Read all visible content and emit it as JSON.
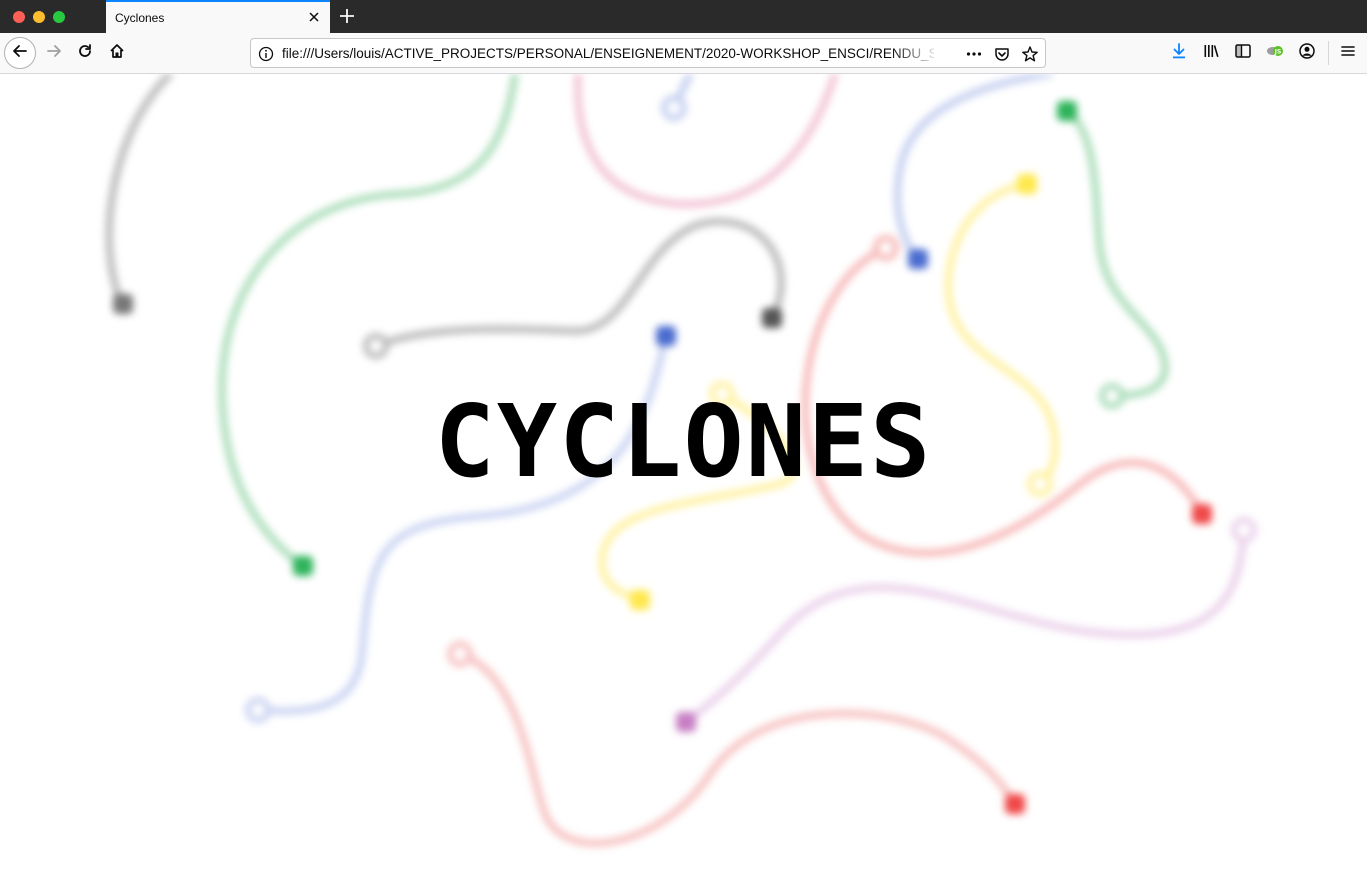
{
  "window": {
    "traffic_lights": [
      "close",
      "minimize",
      "zoom"
    ]
  },
  "tab": {
    "title": "Cyclones",
    "close_icon": "close-icon",
    "active_accent": "#0a84ff"
  },
  "toolbar": {
    "back_icon": "arrow-left-icon",
    "forward_icon": "arrow-right-icon",
    "reload_icon": "reload-icon",
    "home_icon": "home-icon"
  },
  "urlbar": {
    "value": "file:///Users/louis/ACTIVE_PROJECTS/PERSONAL/ENSEIGNEMENT/2020-WORKSHOP_ENSCI/RENDU_S",
    "info_icon": "info-icon",
    "page_actions_icon": "more-horizontal-icon",
    "pocket_icon": "pocket-icon",
    "bookmark_icon": "star-icon"
  },
  "right_toolbar": {
    "download_icon": "download-icon",
    "library_icon": "library-icon",
    "sidebar_icon": "sidebar-icon",
    "extension_icon": "js-extension-icon",
    "extension_badge": "JS",
    "account_icon": "account-icon",
    "menu_icon": "hamburger-menu-icon"
  },
  "page": {
    "headline": "CYCLONES",
    "colors": {
      "gray": "#9a9a9a",
      "green": "#2db35a",
      "blue": "#4a6ccf",
      "pink": "#e98fb5",
      "yellow": "#ffe84d",
      "red": "#f04848",
      "purple": "#c77ec4"
    }
  }
}
